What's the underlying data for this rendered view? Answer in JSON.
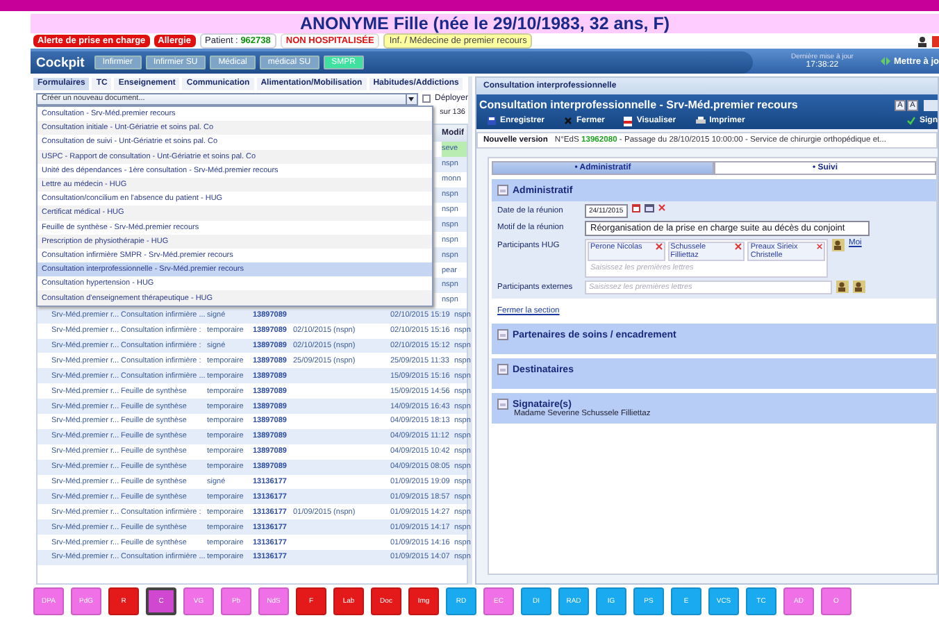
{
  "header": {
    "title": "ANONYME Fille (née le 29/10/1983, 32 ans, F)",
    "badges": [
      {
        "kind": "alert",
        "text": "Alerte de prise en charge"
      },
      {
        "kind": "alert",
        "text": "Allergie"
      },
      {
        "kind": "patient",
        "label": "Patient :",
        "value": "962738"
      },
      {
        "kind": "status",
        "text": "NON HOSPITALISÉE"
      },
      {
        "kind": "unit",
        "text": "Inf. / Médecine de premier recours"
      }
    ]
  },
  "cockpit": {
    "title": "Cockpit",
    "tabs": [
      {
        "label": "Infirmier",
        "selected": false
      },
      {
        "label": "Infirmier SU",
        "selected": false
      },
      {
        "label": "Médical",
        "selected": false
      },
      {
        "label": "médical SU",
        "selected": false
      },
      {
        "label": "SMPR",
        "selected": true
      }
    ],
    "last_update_label": "Dernière mise à jour",
    "last_update_time": "17:38:22",
    "refresh": "Mettre à jo"
  },
  "left": {
    "tabs": [
      {
        "label": "Formulaires",
        "selected": true
      },
      {
        "label": "TC",
        "selected": false
      },
      {
        "label": "Enseignement",
        "selected": false
      },
      {
        "label": "Communication",
        "selected": false
      },
      {
        "label": "Alimentation/Mobilisation",
        "selected": false
      },
      {
        "label": "Habitudes/Addictions",
        "selected": false
      }
    ],
    "new_document": {
      "value": "Créer un nouveau document..."
    },
    "deploy": {
      "label": "Déployer",
      "checked": false
    },
    "counter": "sur 136",
    "dropdown_items": [
      {
        "label": "Consultation - Srv-Méd.premier recours",
        "selected": false
      },
      {
        "label": "Consultation initiale - Unt-Gériatrie et soins pal. Co",
        "selected": false
      },
      {
        "label": "Consultation de suivi - Unt-Gériatrie et soins pal. Co",
        "selected": false
      },
      {
        "label": "USPC - Rapport de consultation - Unt-Gériatrie et soins pal. Co",
        "selected": false
      },
      {
        "label": "Unité des dépendances - 1ère consultation - Srv-Méd.premier recours",
        "selected": false
      },
      {
        "label": "Lettre au médecin - HUG",
        "selected": false
      },
      {
        "label": "Consultation/concilium en l'absence du patient - HUG",
        "selected": false
      },
      {
        "label": "Certificat médical - HUG",
        "selected": false
      },
      {
        "label": "Feuille de synthèse - Srv-Méd.premier recours",
        "selected": false
      },
      {
        "label": "Prescription de physiothérapie - HUG",
        "selected": false
      },
      {
        "label": "Consultation infirmière SMPR - Srv-Méd.premier recours",
        "selected": false
      },
      {
        "label": "Consultation interprofessionnelle - Srv-Méd.premier recours",
        "selected": true
      },
      {
        "label": "Consultation hypertension - HUG",
        "selected": false
      },
      {
        "label": "Consultation d'enseignement thérapeutique - HUG",
        "selected": false
      }
    ],
    "table": {
      "columns": [
        "Modif"
      ],
      "covered_rows": [
        {
          "modif": "seve",
          "selected": true
        },
        {
          "modif": "nspn",
          "selected": false
        },
        {
          "modif": "monn",
          "selected": false
        },
        {
          "modif": "nspn",
          "selected": false
        },
        {
          "modif": "nspn",
          "selected": false
        },
        {
          "modif": "nspn",
          "selected": false
        },
        {
          "modif": "nspn",
          "selected": false
        },
        {
          "modif": "nspn",
          "selected": false
        },
        {
          "modif": "pear",
          "selected": false
        },
        {
          "modif": "nspn",
          "selected": false
        },
        {
          "modif": "nspn",
          "selected": false
        }
      ],
      "rows": [
        {
          "service": "Srv-Méd.premier r...",
          "document": "Consultation infirmière ...",
          "status": "signé",
          "eds": "13897089",
          "note": "",
          "date": "02/10/2015 15:19",
          "modif": "nspn"
        },
        {
          "service": "Srv-Méd.premier r...",
          "document": "Consultation infirmière :",
          "status": "temporaire",
          "eds": "13897089",
          "note": "02/10/2015 (nspn)",
          "date": "02/10/2015 15:16",
          "modif": "nspn"
        },
        {
          "service": "Srv-Méd.premier r...",
          "document": "Consultation infirmière :",
          "status": "signé",
          "eds": "13897089",
          "note": "02/10/2015 (nspn)",
          "date": "02/10/2015 15:12",
          "modif": "nspn"
        },
        {
          "service": "Srv-Méd.premier r...",
          "document": "Consultation infirmière :",
          "status": "temporaire",
          "eds": "13897089",
          "note": "25/09/2015 (nspn)",
          "date": "25/09/2015 11:33",
          "modif": "nspn"
        },
        {
          "service": "Srv-Méd.premier r...",
          "document": "Consultation infirmière ...",
          "status": "temporaire",
          "eds": "13897089",
          "note": "",
          "date": "15/09/2015 15:16",
          "modif": "nspn"
        },
        {
          "service": "Srv-Méd.premier r...",
          "document": "Feuille de synthèse",
          "status": "temporaire",
          "eds": "13897089",
          "note": "",
          "date": "15/09/2015 14:56",
          "modif": "nspn"
        },
        {
          "service": "Srv-Méd.premier r...",
          "document": "Feuille de synthèse",
          "status": "temporaire",
          "eds": "13897089",
          "note": "",
          "date": "14/09/2015 16:43",
          "modif": "nspn"
        },
        {
          "service": "Srv-Méd.premier r...",
          "document": "Feuille de synthèse",
          "status": "temporaire",
          "eds": "13897089",
          "note": "",
          "date": "04/09/2015 18:13",
          "modif": "nspn"
        },
        {
          "service": "Srv-Méd.premier r...",
          "document": "Feuille de synthèse",
          "status": "temporaire",
          "eds": "13897089",
          "note": "",
          "date": "04/09/2015 11:12",
          "modif": "nspn"
        },
        {
          "service": "Srv-Méd.premier r...",
          "document": "Feuille de synthèse",
          "status": "temporaire",
          "eds": "13897089",
          "note": "",
          "date": "04/09/2015 10:42",
          "modif": "nspn"
        },
        {
          "service": "Srv-Méd.premier r...",
          "document": "Feuille de synthèse",
          "status": "temporaire",
          "eds": "13897089",
          "note": "",
          "date": "04/09/2015 08:05",
          "modif": "nspn"
        },
        {
          "service": "Srv-Méd.premier r...",
          "document": "Feuille de synthèse",
          "status": "signé",
          "eds": "13136177",
          "note": "",
          "date": "01/09/2015 19:09",
          "modif": "nspn"
        },
        {
          "service": "Srv-Méd.premier r...",
          "document": "Feuille de synthèse",
          "status": "temporaire",
          "eds": "13136177",
          "note": "",
          "date": "01/09/2015 18:57",
          "modif": "nspn"
        },
        {
          "service": "Srv-Méd.premier r...",
          "document": "Consultation infirmière :",
          "status": "temporaire",
          "eds": "13136177",
          "note": "01/09/2015 (nspn)",
          "date": "01/09/2015 14:27",
          "modif": "nspn"
        },
        {
          "service": "Srv-Méd.premier r...",
          "document": "Feuille de synthèse",
          "status": "temporaire",
          "eds": "13136177",
          "note": "",
          "date": "01/09/2015 14:17",
          "modif": "nspn"
        },
        {
          "service": "Srv-Méd.premier r...",
          "document": "Feuille de synthèse",
          "status": "temporaire",
          "eds": "13136177",
          "note": "",
          "date": "01/09/2015 14:16",
          "modif": "nspn"
        },
        {
          "service": "Srv-Méd.premier r...",
          "document": "Consultation infirmière ...",
          "status": "temporaire",
          "eds": "13136177",
          "note": "",
          "date": "01/09/2015 14:07",
          "modif": "nspn"
        }
      ]
    }
  },
  "right": {
    "window_title": "Consultation interprofessionnelle",
    "doc_title": "Consultation interprofessionnelle - Srv-Méd.premier recours",
    "font_buttons": [
      "A",
      "A"
    ],
    "toolbar": [
      {
        "kind": "save",
        "label": "Enregistrer"
      },
      {
        "kind": "close",
        "label": "Fermer"
      },
      {
        "kind": "pdf",
        "label": "Visualiser"
      },
      {
        "kind": "print",
        "label": "Imprimer"
      },
      {
        "kind": "sign",
        "label": "Sign"
      }
    ],
    "version": {
      "label": "Nouvelle version",
      "prefix": "N°EdS",
      "eds": "13962080",
      "text": "- Passage du 28/10/2015 10:00:00 - Service de chirurgie orthopédique et..."
    },
    "tabs": [
      {
        "label": "• Administratif",
        "selected": true
      },
      {
        "label": "• Suivi",
        "selected": false
      }
    ],
    "section": {
      "title": "Administratif",
      "date_label": "Date de la réunion",
      "date": "24/11/2015",
      "motif_label": "Motif de la réunion",
      "motif": "Réorganisation de la prise en charge suite au décès du conjoint",
      "hug_label": "Participants HUG",
      "participants": [
        "Perone Nicolas",
        "Schussele Filliettaz",
        "Preaux Sirieix Christelle"
      ],
      "placeholder": "Saisissez les premières lettres",
      "me_link": "Moi",
      "ext_label": "Participants externes",
      "ext_placeholder": "Saisissez les premières lettres",
      "close_link": "Fermer la section"
    },
    "collapsed": [
      {
        "title": "Partenaires de soins / encadrement"
      },
      {
        "title": "Destinataires"
      },
      {
        "title": "Signataire(s)",
        "subtitle": "Madame Severine Schussele Filliettaz"
      }
    ]
  },
  "bottom_buttons": [
    {
      "label": "DPA",
      "color": "#f070e8",
      "selected": false
    },
    {
      "label": "PdG",
      "color": "#f070e8",
      "selected": false
    },
    {
      "label": "R",
      "color": "#e41a1a",
      "selected": false
    },
    {
      "label": "C",
      "color": "#d048d0",
      "selected": true
    },
    {
      "label": "VG",
      "color": "#f070e8",
      "selected": false
    },
    {
      "label": "Pb",
      "color": "#f070e8",
      "selected": false
    },
    {
      "label": "NdS",
      "color": "#f070e8",
      "selected": false
    },
    {
      "label": "F",
      "color": "#e41a1a",
      "selected": false
    },
    {
      "label": "Lab",
      "color": "#e41a1a",
      "selected": false
    },
    {
      "label": "Doc",
      "color": "#e41a1a",
      "selected": false
    },
    {
      "label": "Img",
      "color": "#e41a1a",
      "selected": false
    },
    {
      "label": "RD",
      "color": "#1aaaf0",
      "selected": false
    },
    {
      "label": "EC",
      "color": "#f070e8",
      "selected": false
    },
    {
      "label": "DI",
      "color": "#1aaaf0",
      "selected": false
    },
    {
      "label": "RAD",
      "color": "#1aaaf0",
      "selected": false
    },
    {
      "label": "IG",
      "color": "#1aaaf0",
      "selected": false
    },
    {
      "label": "PS",
      "color": "#1aaaf0",
      "selected": false
    },
    {
      "label": "E",
      "color": "#1aaaf0",
      "selected": false
    },
    {
      "label": "VCS",
      "color": "#1aaaf0",
      "selected": false
    },
    {
      "label": "TC",
      "color": "#1aaaf0",
      "selected": false
    },
    {
      "label": "AD",
      "color": "#f070e8",
      "selected": false
    },
    {
      "label": "O",
      "color": "#f070e8",
      "selected": false
    }
  ]
}
